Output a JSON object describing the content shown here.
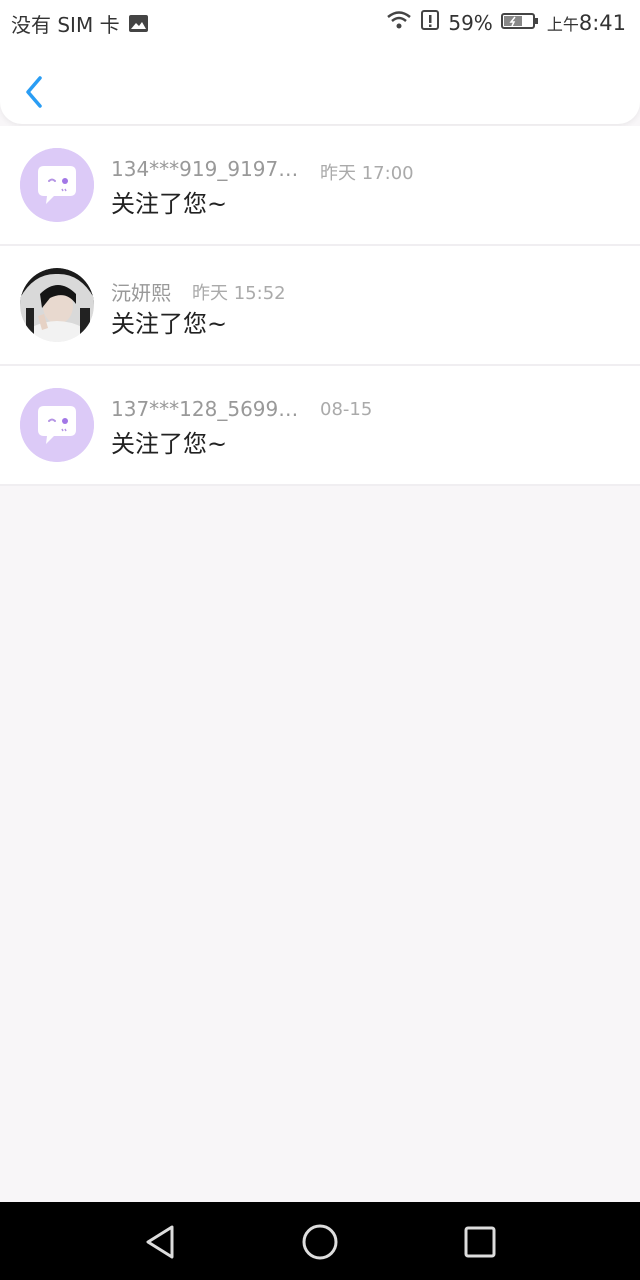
{
  "status_bar": {
    "carrier": "没有 SIM 卡",
    "battery_percent": "59%",
    "ampm": "上午",
    "time": "8:41",
    "icons": [
      "image-icon",
      "wifi-icon",
      "alert-icon",
      "battery-icon"
    ]
  },
  "header": {
    "back_icon": "chevron-left-icon",
    "accent_color": "#2a9df4"
  },
  "notifications": [
    {
      "name": "134***919_919742...",
      "time": "昨天 17:00",
      "message": "关注了您~",
      "avatar": "default-chat-avatar"
    },
    {
      "name": "沅妍熙",
      "time": "昨天 15:52",
      "message": "关注了您~",
      "avatar": "user-photo-avatar"
    },
    {
      "name": "137***128_56999...",
      "time": "08-15",
      "message": "关注了您~",
      "avatar": "default-chat-avatar"
    }
  ],
  "nav_bar": {
    "buttons": [
      "back-triangle-icon",
      "home-circle-icon",
      "recents-square-icon"
    ]
  }
}
